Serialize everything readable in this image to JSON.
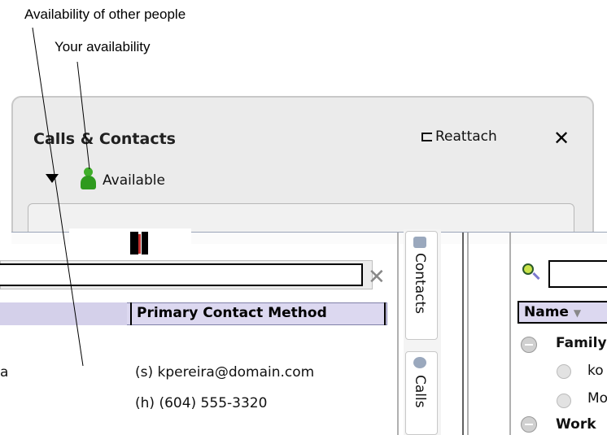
{
  "callouts": {
    "others": "Availability of other people",
    "yours": "Your availability"
  },
  "window": {
    "title": "Calls & Contacts",
    "reattach_label": "Reattach",
    "close_label": "✕",
    "status_label": "Available"
  },
  "vertical_tabs": {
    "contacts": "Contacts",
    "calls": "Calls"
  },
  "table": {
    "primary_header": "Primary Contact Method",
    "row1_name_fragment": "a",
    "row1_contact": "(s) kpereira@domain.com",
    "row2_contact": "(h) (604) 555-3320"
  },
  "right_panel": {
    "name_header": "Name",
    "sort_indicator": "▼",
    "group1": "Family",
    "item1": "ko",
    "item2": "Mo",
    "group2": "Work"
  },
  "colors": {
    "available_green": "#2e9a1e",
    "header_bg": "#dcd8f0"
  }
}
